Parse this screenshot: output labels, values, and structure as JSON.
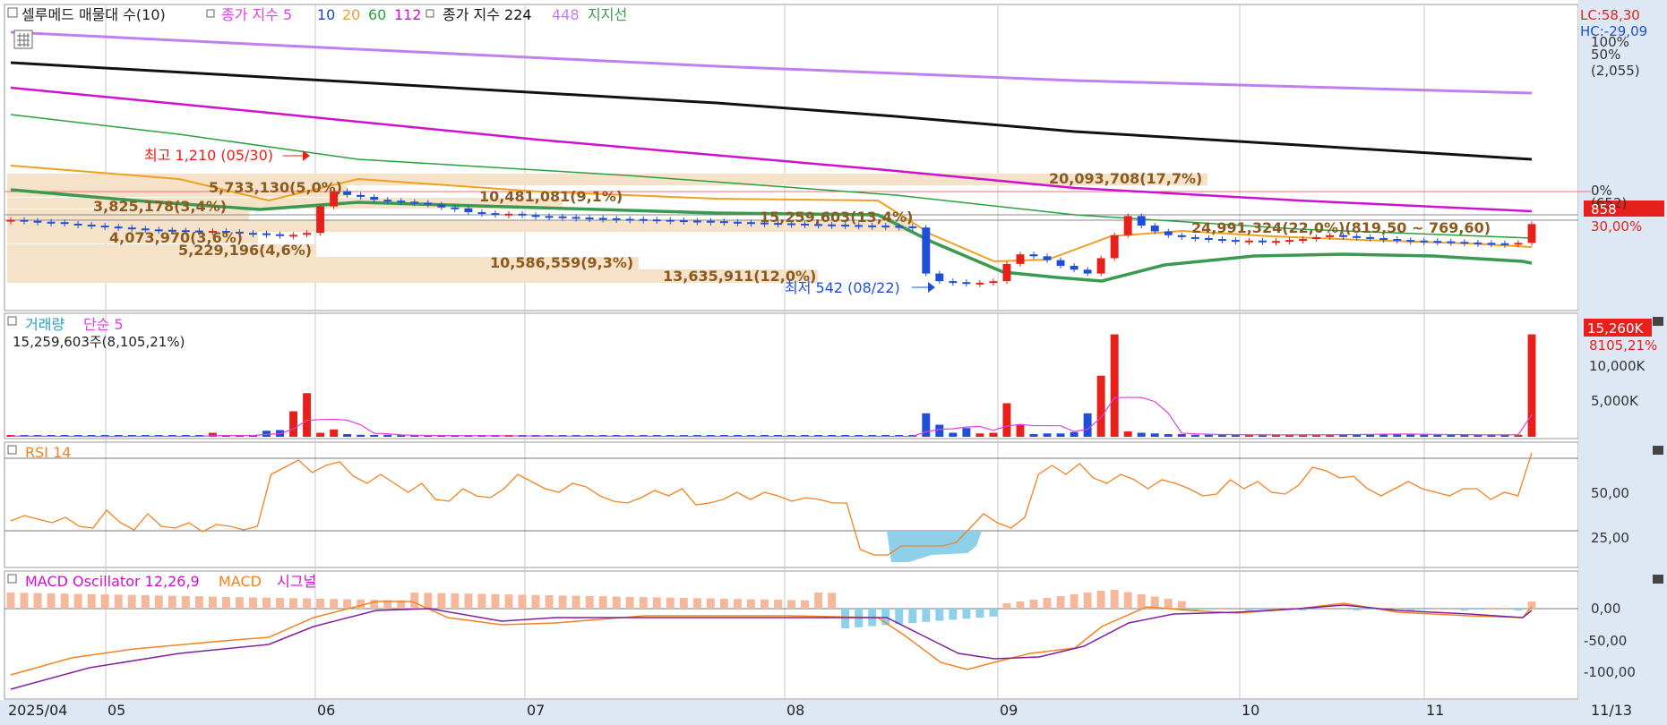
{
  "legend_top": {
    "title": "셀루메드 매물대 수(10)",
    "ma_label": "종가 지수 5",
    "ma10": "10",
    "ma20": "20",
    "ma60": "60",
    "ma112": "112",
    "ma224_label": "종가 지수 224",
    "ma448": "448",
    "support": "지지선"
  },
  "right_info": {
    "lc": "LC:58,30",
    "hc": "HC:-29,09",
    "p100": "100%",
    "p50": "50%",
    "p_max": "(2,055)",
    "p0": "0%",
    "p_min": "(652)",
    "current_price": "858",
    "current_pct": "30,00%"
  },
  "annotations": {
    "high": "최고 1,210 (05/30)",
    "low": "최저 542 (08/22)",
    "range": "24,991,324(22,0%)(819,50 ~ 769,60)",
    "vp_1": "20,093,708(17,7%)",
    "vp_2": "5,733,130(5,0%)",
    "vp_3": "10,481,081(9,1%)",
    "vp_4": "3,825,178(3,4%)",
    "vp_5": "15,259,603(13,4%)",
    "vp_6": "4,073,970(3,6%)",
    "vp_7": "5,229,196(4,6%)",
    "vp_8": "10,586,559(9,3%)",
    "vp_9": "13,635,911(12,0%)"
  },
  "volume_panel": {
    "label": "거래량",
    "ma_label": "단순 5",
    "value_text": "15,259,603주(8,105,21%)",
    "badge_value": "15,260K",
    "badge_pct": "8105,21%",
    "tick_10000": "10,000K",
    "tick_5000": "5,000K"
  },
  "rsi_panel": {
    "label": "RSI 14",
    "tick_50": "50,00",
    "tick_25": "25,00"
  },
  "macd_panel": {
    "osc_label": "MACD Oscillator 12,26,9",
    "macd_label": "MACD",
    "signal_label": "시그널",
    "tick_0": "0,00",
    "tick_m50": "-50,00",
    "tick_m100": "-100,00"
  },
  "x_axis": {
    "labels": [
      "2025/04",
      "05",
      "06",
      "07",
      "08",
      "09",
      "10",
      "11",
      "11/13"
    ]
  },
  "colors": {
    "up": "#e8201c",
    "down": "#1f4fd8",
    "ma5": "#e040e0",
    "ma10": "#2040d0",
    "ma20": "#f0a020",
    "ma60": "#2aa040",
    "ma112": "#d010d0",
    "ma224": "#111111",
    "ma448": "#c080f0",
    "support": "#3a9a50",
    "rsi": "#f58220",
    "macd": "#f58220",
    "signal": "#8020a0"
  },
  "chart_data": {
    "type": "candlestick",
    "price_range": [
      652,
      2055
    ],
    "high_point": {
      "date": "05/30",
      "value": 1210
    },
    "low_point": {
      "date": "08/22",
      "value": 542
    },
    "close_series": [
      880,
      875,
      870,
      868,
      860,
      855,
      850,
      845,
      840,
      835,
      830,
      828,
      826,
      824,
      820,
      822,
      818,
      812,
      810,
      805,
      800,
      802,
      812,
      950,
      1030,
      1010,
      1000,
      985,
      980,
      975,
      970,
      960,
      945,
      940,
      920,
      915,
      910,
      912,
      905,
      900,
      898,
      895,
      892,
      890,
      888,
      885,
      884,
      882,
      880,
      878,
      876,
      875,
      873,
      870,
      868,
      866,
      864,
      862,
      860,
      858,
      856,
      855,
      853,
      851,
      850,
      848,
      846,
      840,
      600,
      560,
      555,
      548,
      552,
      560,
      650,
      700,
      690,
      670,
      640,
      620,
      600,
      680,
      800,
      900,
      850,
      820,
      800,
      790,
      785,
      780,
      775,
      770,
      772,
      768,
      770,
      775,
      780,
      790,
      800,
      795,
      790,
      785,
      780,
      775,
      772,
      770,
      768,
      765,
      762,
      760,
      758,
      755,
      760,
      858
    ],
    "volume_k": [
      100,
      80,
      60,
      60,
      70,
      50,
      40,
      50,
      60,
      90,
      70,
      60,
      60,
      60,
      50,
      600,
      200,
      80,
      60,
      900,
      1000,
      3800,
      6500,
      600,
      1100,
      400,
      300,
      200,
      300,
      200,
      150,
      200,
      160,
      150,
      150,
      150,
      120,
      100,
      100,
      90,
      90,
      80,
      80,
      80,
      80,
      80,
      80,
      80,
      70,
      70,
      70,
      60,
      60,
      60,
      60,
      60,
      60,
      60,
      60,
      60,
      60,
      60,
      60,
      60,
      60,
      60,
      60,
      60,
      3500,
      1800,
      600,
      1300,
      500,
      600,
      5000,
      1800,
      400,
      500,
      500,
      700,
      3500,
      9100,
      15259,
      800,
      600,
      500,
      400,
      400,
      300,
      300,
      300,
      300,
      300,
      300,
      300,
      300,
      300,
      300,
      300,
      400,
      400,
      400,
      400,
      400,
      400,
      300,
      300,
      300,
      300,
      300,
      300,
      300,
      300,
      15259
    ],
    "rsi": [
      34,
      37,
      35,
      33,
      36,
      31,
      30,
      40,
      33,
      29,
      38,
      31,
      30,
      33,
      28,
      32,
      31,
      29,
      31,
      60,
      64,
      68,
      61,
      65,
      67,
      59,
      55,
      60,
      55,
      50,
      55,
      46,
      45,
      52,
      48,
      47,
      52,
      60,
      56,
      52,
      50,
      55,
      53,
      48,
      45,
      44,
      47,
      51,
      48,
      52,
      43,
      44,
      46,
      50,
      46,
      50,
      48,
      45,
      47,
      46,
      44,
      44,
      18,
      15,
      15,
      20,
      20,
      20,
      20,
      22,
      30,
      38,
      33,
      30,
      36,
      60,
      65,
      60,
      66,
      58,
      55,
      60,
      57,
      52,
      57,
      55,
      52,
      48,
      49,
      57,
      52,
      56,
      50,
      49,
      54,
      64,
      62,
      58,
      59,
      52,
      48,
      52,
      56,
      52,
      50,
      48,
      52,
      52,
      46,
      50,
      48,
      72
    ],
    "ylim_rsi": [
      0,
      100
    ],
    "macd_ylim": [
      -130,
      40
    ],
    "x_labels": [
      "2025/04",
      "05",
      "06",
      "07",
      "08",
      "09",
      "10",
      "11",
      "11/13"
    ]
  }
}
